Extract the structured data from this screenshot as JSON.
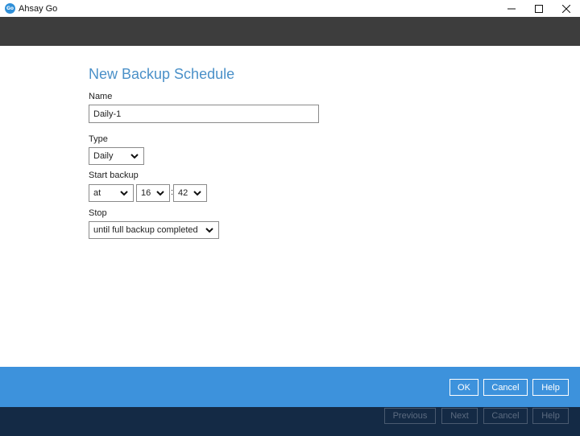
{
  "window": {
    "app_icon_text": "Go",
    "title": "Ahsay Go"
  },
  "page": {
    "title": "New Backup Schedule"
  },
  "form": {
    "name_label": "Name",
    "name_value": "Daily-1",
    "type_label": "Type",
    "type_value": "Daily",
    "start_label": "Start backup",
    "start_mode": "at",
    "start_hour": "16",
    "time_separator": ":",
    "start_minute": "42",
    "stop_label": "Stop",
    "stop_value": "until full backup completed"
  },
  "footer": {
    "ok": "OK",
    "cancel": "Cancel",
    "help": "Help"
  },
  "background_nav": {
    "previous": "Previous",
    "next": "Next",
    "cancel": "Cancel",
    "help": "Help"
  },
  "colors": {
    "accent_title": "#4a90c8",
    "footer_bg": "#3d92dc",
    "header_bg": "#3d3d3d",
    "bottom_bg": "#142a45"
  }
}
